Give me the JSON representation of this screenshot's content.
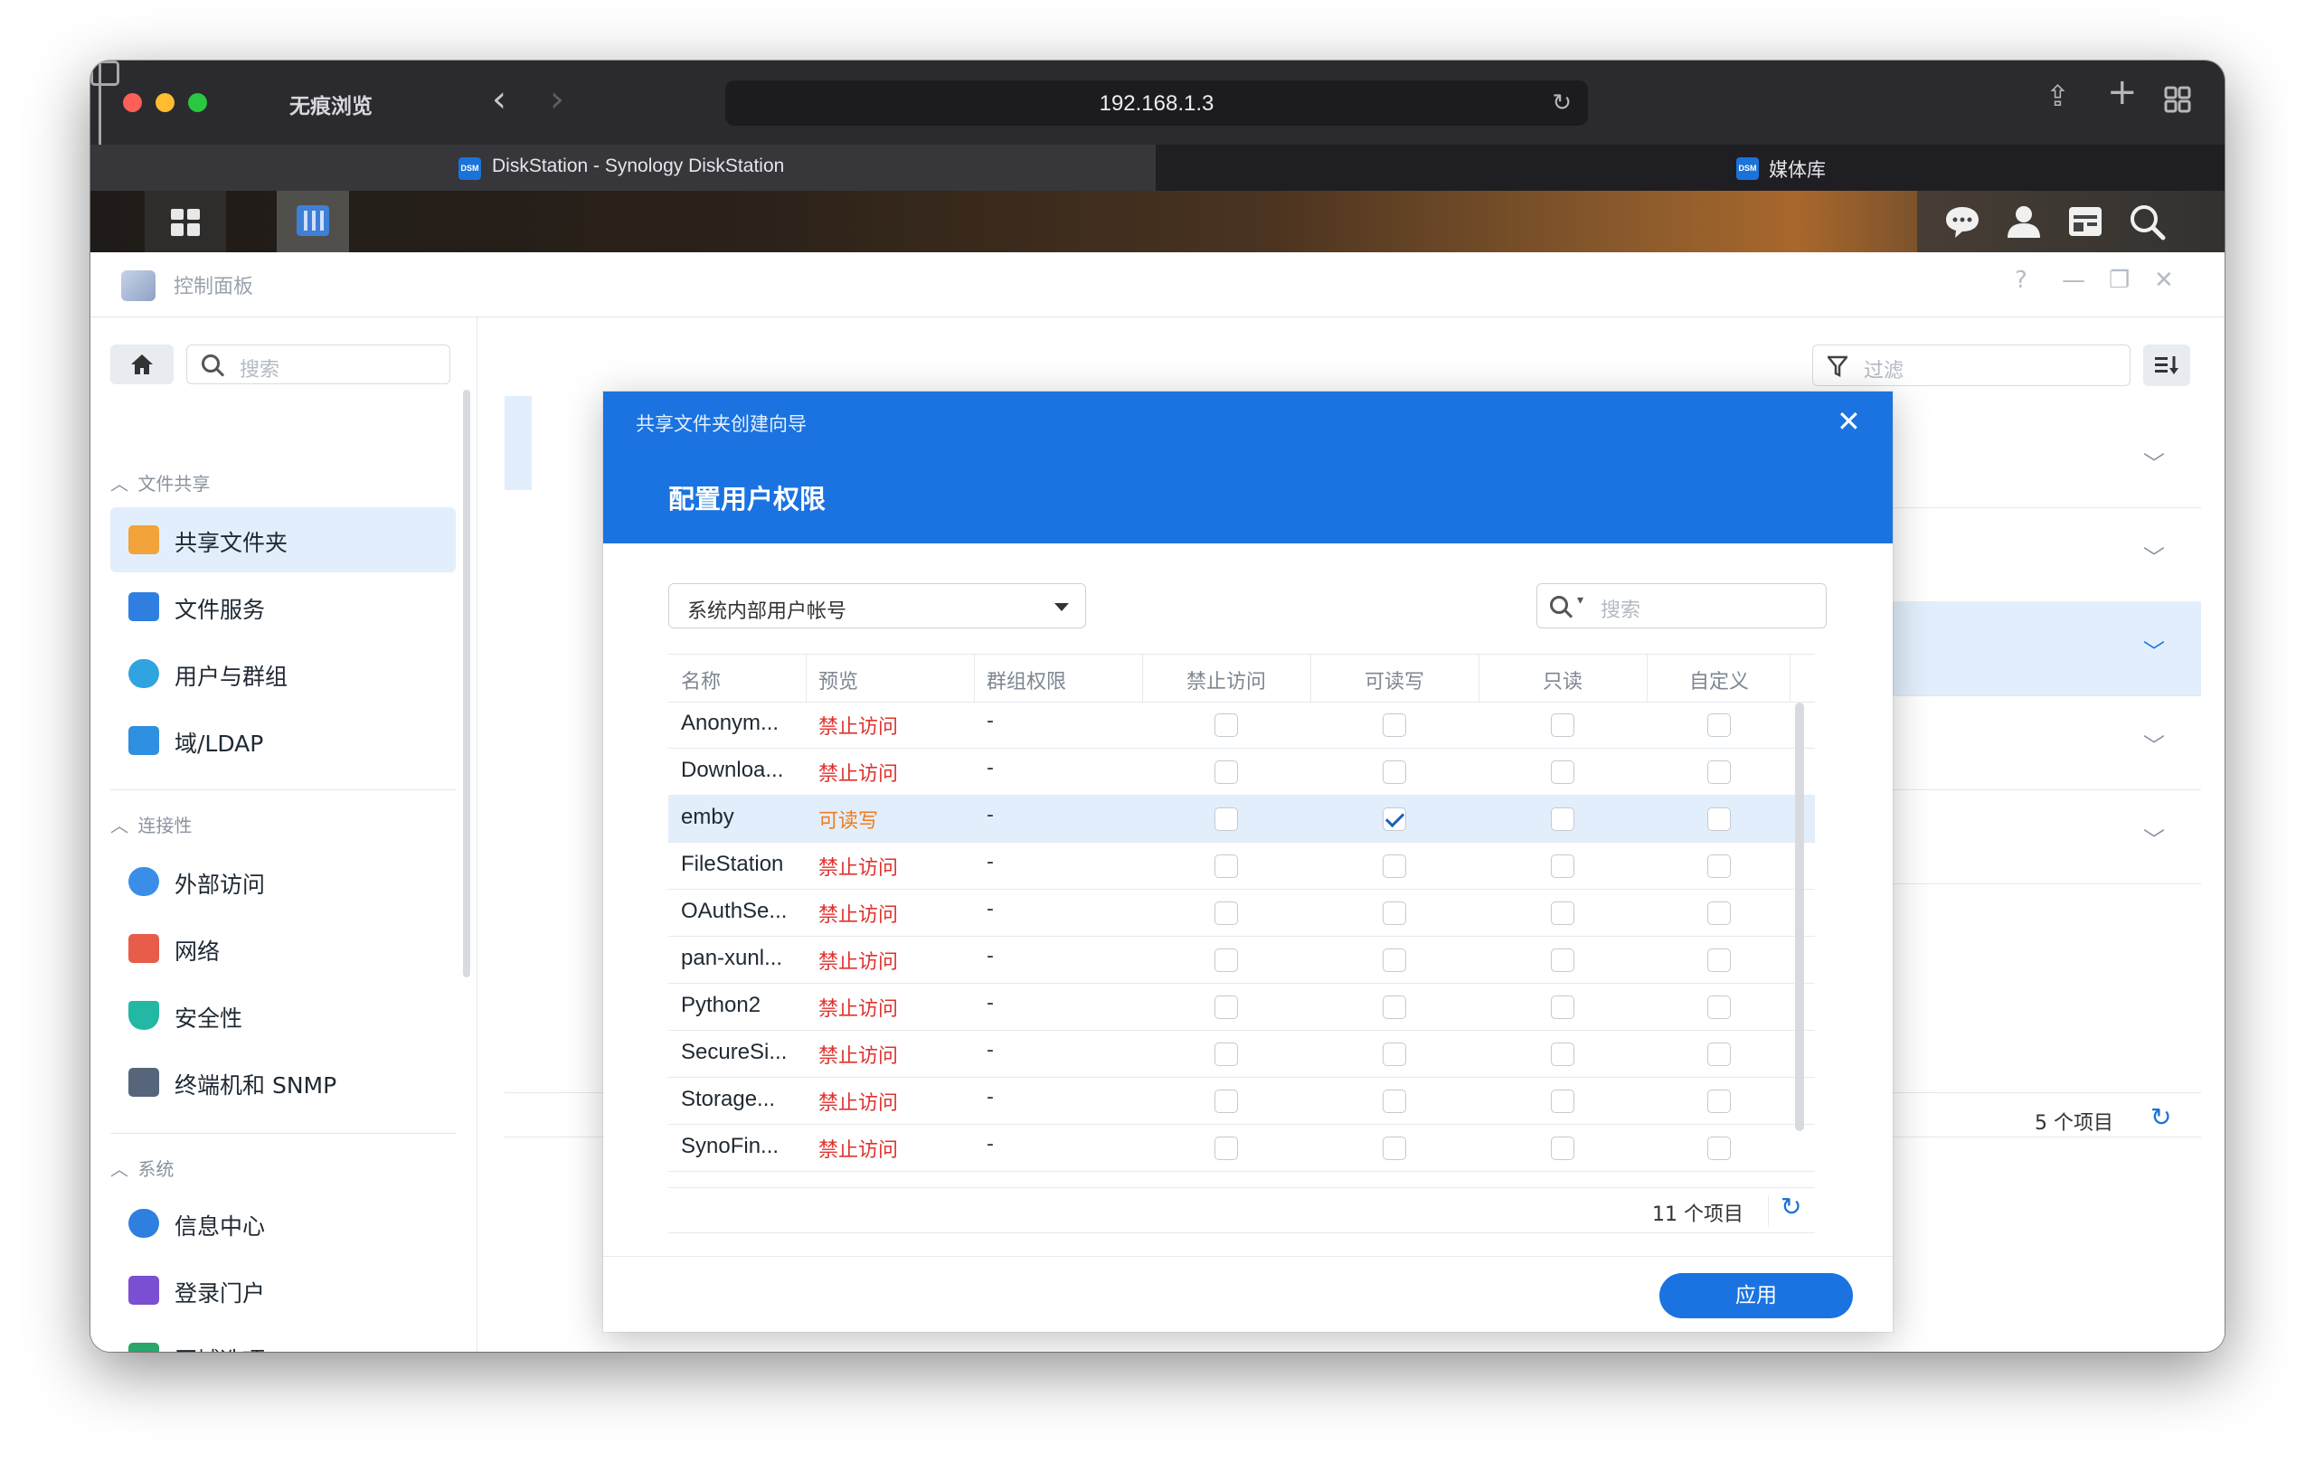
{
  "browser": {
    "private_label": "无痕浏览",
    "url": "192.168.1.3",
    "tabs": [
      {
        "title": "DiskStation - Synology DiskStation",
        "favicon": "DSM"
      },
      {
        "title": "媒体库",
        "favicon": "DSM"
      }
    ]
  },
  "app": {
    "title": "控制面板"
  },
  "sidebar": {
    "search_placeholder": "搜索",
    "sections": [
      {
        "label": "文件共享"
      },
      {
        "label": "连接性"
      },
      {
        "label": "系统"
      }
    ],
    "items": [
      {
        "label": "共享文件夹",
        "icon": "shared-folder-icon",
        "color": "#f2a33a",
        "active": true
      },
      {
        "label": "文件服务",
        "icon": "file-services-icon",
        "color": "#2f7fe0"
      },
      {
        "label": "用户与群组",
        "icon": "users-icon",
        "color": "#2fa4e0"
      },
      {
        "label": "域/LDAP",
        "icon": "ldap-icon",
        "color": "#2f8fe0"
      },
      {
        "label": "外部访问",
        "icon": "external-access-icon",
        "color": "#3a8ee8"
      },
      {
        "label": "网络",
        "icon": "network-icon",
        "color": "#e85c4a"
      },
      {
        "label": "安全性",
        "icon": "security-icon",
        "color": "#23b8a3"
      },
      {
        "label": "终端机和 SNMP",
        "icon": "terminal-icon",
        "color": "#56657a"
      },
      {
        "label": "信息中心",
        "icon": "info-center-icon",
        "color": "#2f7fe0"
      },
      {
        "label": "登录门户",
        "icon": "login-portal-icon",
        "color": "#7a4fd1"
      },
      {
        "label": "区域选项",
        "icon": "regional-options-icon",
        "color": "#2aa66a"
      }
    ]
  },
  "main": {
    "filter_placeholder": "过滤",
    "item_count": "5 个项目"
  },
  "wizard": {
    "window_title": "共享文件夹创建向导",
    "step_title": "配置用户权限",
    "user_type": "系统内部用户帐号",
    "search_placeholder": "搜索",
    "columns": [
      "名称",
      "预览",
      "群组权限",
      "禁止访问",
      "可读写",
      "只读",
      "自定义"
    ],
    "rows": [
      {
        "name": "Anonym...",
        "preview": "禁止访问",
        "group": "-",
        "deny": false,
        "rw": false,
        "ro": false,
        "custom": false
      },
      {
        "name": "Downloa...",
        "preview": "禁止访问",
        "group": "-",
        "deny": false,
        "rw": false,
        "ro": false,
        "custom": false
      },
      {
        "name": "emby",
        "preview": "可读写",
        "group": "-",
        "deny": false,
        "rw": true,
        "ro": false,
        "custom": false
      },
      {
        "name": "FileStation",
        "preview": "禁止访问",
        "group": "-",
        "deny": false,
        "rw": false,
        "ro": false,
        "custom": false
      },
      {
        "name": "OAuthSe...",
        "preview": "禁止访问",
        "group": "-",
        "deny": false,
        "rw": false,
        "ro": false,
        "custom": false
      },
      {
        "name": "pan-xunl...",
        "preview": "禁止访问",
        "group": "-",
        "deny": false,
        "rw": false,
        "ro": false,
        "custom": false
      },
      {
        "name": "Python2",
        "preview": "禁止访问",
        "group": "-",
        "deny": false,
        "rw": false,
        "ro": false,
        "custom": false
      },
      {
        "name": "SecureSi...",
        "preview": "禁止访问",
        "group": "-",
        "deny": false,
        "rw": false,
        "ro": false,
        "custom": false
      },
      {
        "name": "Storage...",
        "preview": "禁止访问",
        "group": "-",
        "deny": false,
        "rw": false,
        "ro": false,
        "custom": false
      },
      {
        "name": "SynoFin...",
        "preview": "禁止访问",
        "group": "-",
        "deny": false,
        "rw": false,
        "ro": false,
        "custom": false
      }
    ],
    "item_count": "11 个项目",
    "apply_label": "应用"
  },
  "colors": {
    "accent": "#1a73e0",
    "deny": "#e0322e",
    "readwrite": "#ef7c1c"
  }
}
